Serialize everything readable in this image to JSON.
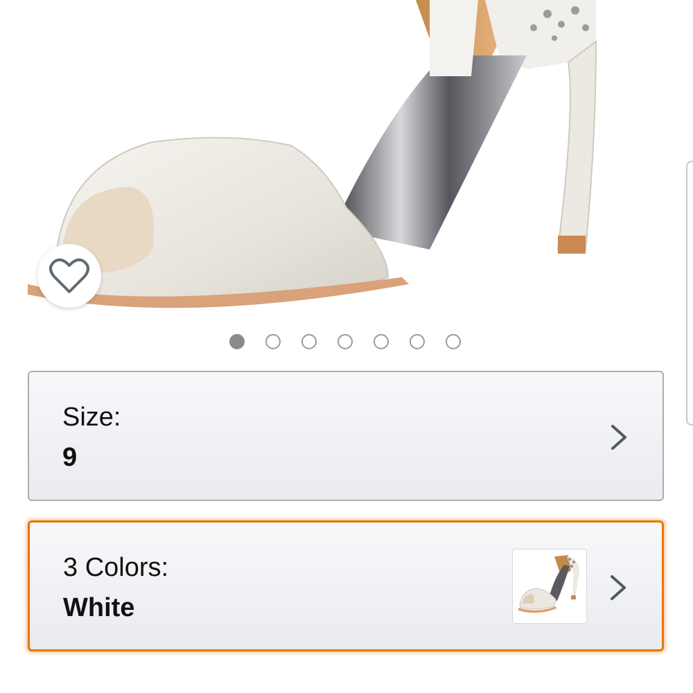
{
  "product": {
    "image_icon": "high-heel-sandal-image",
    "carousel": {
      "count": 7,
      "active_index": 0
    }
  },
  "wishlist": {
    "icon": "heart-icon"
  },
  "size_selector": {
    "label": "Size:",
    "value": "9",
    "icon": "chevron-right-icon"
  },
  "color_selector": {
    "label": "3 Colors:",
    "value": "White",
    "icon": "chevron-right-icon",
    "thumbnail_icon": "sandal-thumbnail-image"
  },
  "colors": {
    "accent_orange": "#e77600",
    "border_gray": "#a9adb3",
    "text": "#111111"
  }
}
